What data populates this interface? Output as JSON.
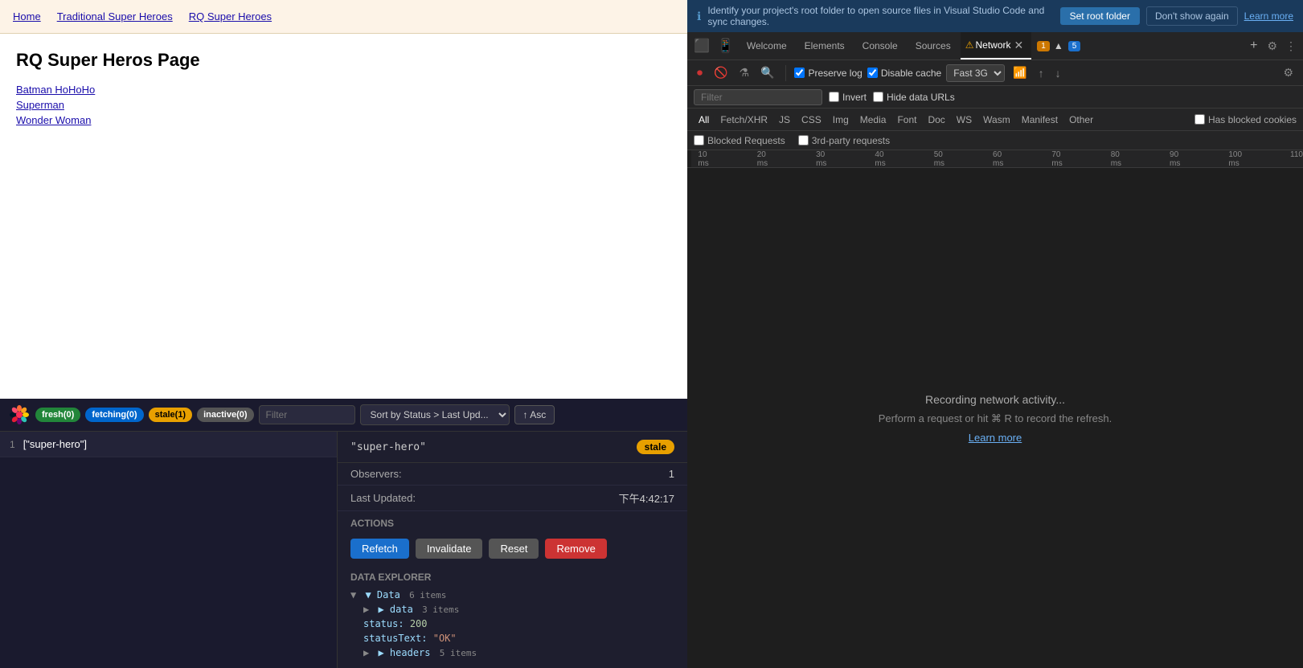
{
  "page": {
    "nav": {
      "links": [
        "Home",
        "Traditional Super Heroes",
        "RQ Super Heroes"
      ]
    },
    "title": "RQ Super Heros Page",
    "heroes": [
      "Batman HoHoHo",
      "Superman",
      "Wonder Woman"
    ]
  },
  "rq_devtools": {
    "badges": {
      "fresh": "fresh(0)",
      "fetching": "fetching(0)",
      "stale": "stale(1)",
      "inactive": "inactive(0)"
    },
    "filter_placeholder": "Filter",
    "sort_label": "Sort by Status > Last Upd...",
    "asc_label": "↑ Asc",
    "query_list": [
      {
        "num": "1",
        "key": "[\"super-hero\"]"
      }
    ],
    "details": {
      "key": "\"super-hero\"",
      "status": "stale",
      "observers_label": "Observers:",
      "observers_val": "1",
      "last_updated_label": "Last Updated:",
      "last_updated_val": "下午4:42:17",
      "actions_label": "Actions",
      "btn_refetch": "Refetch",
      "btn_invalidate": "Invalidate",
      "btn_reset": "Reset",
      "btn_remove": "Remove",
      "data_explorer_label": "Data Explorer",
      "data_label": "▼ Data",
      "data_count": "6 items",
      "data_sub": "▶ data",
      "data_sub_count": "3 items",
      "status_line": "status: 200",
      "status_text_line": "statusText: \"OK\"",
      "headers_line": "▶ headers",
      "headers_count": "5 items"
    }
  },
  "devtools": {
    "info_bar": {
      "text": "Identify your project's root folder to open source files in Visual Studio Code and sync changes.",
      "btn_root": "Set root folder",
      "btn_dont_show": "Don't show again",
      "learn_more": "Learn more"
    },
    "tabs": {
      "items": [
        "Welcome",
        "Elements",
        "Console",
        "Sources"
      ],
      "active": "Network",
      "network_label": "Network",
      "warning_count": "1",
      "info_count": "5"
    },
    "toolbar": {
      "preserve_log_label": "Preserve log",
      "disable_cache_label": "Disable cache",
      "speed_label": "Fast 3G",
      "invert_label": "Invert",
      "hide_data_urls_label": "Hide data URLs"
    },
    "type_tabs": {
      "items": [
        "All",
        "Fetch/XHR",
        "JS",
        "CSS",
        "Img",
        "Media",
        "Font",
        "Doc",
        "WS",
        "Wasm",
        "Manifest",
        "Other"
      ],
      "active": "All",
      "has_blocked": "Has blocked cookies"
    },
    "blocked_row": {
      "blocked_requests": "Blocked Requests",
      "third_party": "3rd-party requests"
    },
    "timeline": {
      "marks": [
        "10 ms",
        "20 ms",
        "30 ms",
        "40 ms",
        "50 ms",
        "60 ms",
        "70 ms",
        "80 ms",
        "90 ms",
        "100 ms",
        "110"
      ]
    },
    "recording": {
      "main": "Recording network activity...",
      "sub": "Perform a request or hit ⌘ R to record the refresh.",
      "learn_more": "Learn more"
    }
  }
}
